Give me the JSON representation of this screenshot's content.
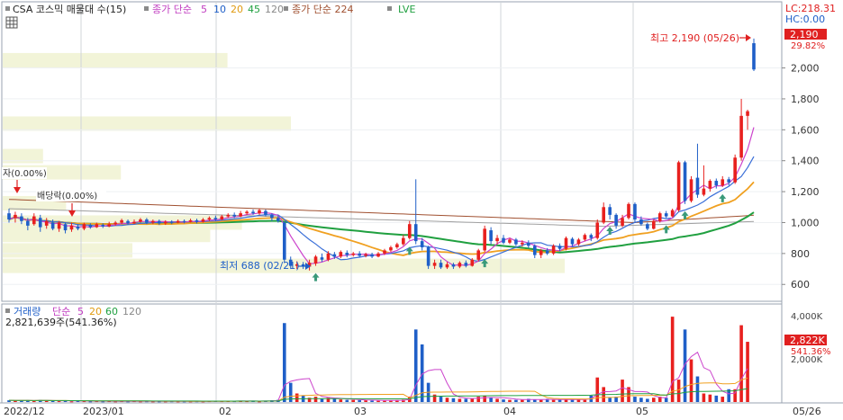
{
  "colors": {
    "up": "#e8201e",
    "down": "#1f5fc8",
    "ma5": "#cc44cc",
    "ma20": "#f0a020",
    "ma60": "#20a040",
    "ma120": "#a0a0a0",
    "ma224": "#a05030",
    "highlight": "#f2f4d8",
    "arrow_up": "#3a9a7a",
    "arrow_down": "#e02020"
  },
  "header": {
    "legend_title": "CSA 코스믹 매물대 수(15)",
    "price_ma_label": "종가 단순",
    "ma_periods": [
      "5",
      "10",
      "20",
      "45",
      "120"
    ],
    "ma224_label": "종가 단순 224",
    "lve_label": "LVE",
    "lc_label": "LC:218.31",
    "hc_label": "HC:0.00"
  },
  "annotations": {
    "high_label": "최고 2,190 (05/26)",
    "low_label": "최저 688 (02/21)",
    "div1": "자(0.00%)",
    "div2": "배당락(0.00%)"
  },
  "price_axis": {
    "ticks": [
      "2,000",
      "1,800",
      "1,600",
      "1,400",
      "1,200",
      "1,000",
      "800",
      "600"
    ],
    "current_price": "2,190",
    "current_change": "29.82%"
  },
  "volume_panel": {
    "legend_title": "거래량",
    "legend_ma_label": "단순",
    "legend_periods": [
      "5",
      "20",
      "60",
      "120"
    ],
    "current_volume": "2,821,639주(541.36%)",
    "ticks": [
      "4,000K",
      "2,000K"
    ],
    "current_value": "2,822K",
    "current_change": "541.36%"
  },
  "x_axis": {
    "labels": [
      "2022/12",
      "2023/01",
      "02",
      "03",
      "04",
      "05",
      "05/26"
    ]
  },
  "chart_data": {
    "type": "candlestick",
    "price_range": [
      520,
      2230
    ],
    "volume_range_k": [
      0,
      4300
    ],
    "series_price": [
      {
        "o": 1060,
        "c": 1020,
        "h": 1090,
        "l": 1000
      },
      {
        "o": 1030,
        "c": 1050,
        "h": 1070,
        "l": 1000
      },
      {
        "o": 1040,
        "c": 1010,
        "h": 1060,
        "l": 990
      },
      {
        "o": 1010,
        "c": 980,
        "h": 1030,
        "l": 950
      },
      {
        "o": 990,
        "c": 1040,
        "h": 1060,
        "l": 980
      },
      {
        "o": 1030,
        "c": 970,
        "h": 1050,
        "l": 940
      },
      {
        "o": 980,
        "c": 1010,
        "h": 1030,
        "l": 960
      },
      {
        "o": 1000,
        "c": 960,
        "h": 1020,
        "l": 950
      },
      {
        "o": 960,
        "c": 1000,
        "h": 1010,
        "l": 940
      },
      {
        "o": 990,
        "c": 950,
        "h": 1000,
        "l": 930
      },
      {
        "o": 955,
        "c": 980,
        "h": 1000,
        "l": 940
      },
      {
        "o": 975,
        "c": 960,
        "h": 990,
        "l": 950
      },
      {
        "o": 960,
        "c": 990,
        "h": 1000,
        "l": 950
      },
      {
        "o": 985,
        "c": 970,
        "h": 995,
        "l": 960
      },
      {
        "o": 970,
        "c": 990,
        "h": 1000,
        "l": 965
      },
      {
        "o": 985,
        "c": 975,
        "h": 995,
        "l": 965
      },
      {
        "o": 975,
        "c": 990,
        "h": 1005,
        "l": 970
      },
      {
        "o": 990,
        "c": 1000,
        "h": 1010,
        "l": 980
      },
      {
        "o": 1000,
        "c": 1015,
        "h": 1025,
        "l": 990
      },
      {
        "o": 1010,
        "c": 995,
        "h": 1020,
        "l": 985
      },
      {
        "o": 995,
        "c": 1005,
        "h": 1020,
        "l": 990
      },
      {
        "o": 1005,
        "c": 1020,
        "h": 1030,
        "l": 1000
      },
      {
        "o": 1020,
        "c": 1000,
        "h": 1030,
        "l": 990
      },
      {
        "o": 1000,
        "c": 1010,
        "h": 1020,
        "l": 990
      },
      {
        "o": 1010,
        "c": 995,
        "h": 1020,
        "l": 985
      },
      {
        "o": 995,
        "c": 1005,
        "h": 1015,
        "l": 985
      },
      {
        "o": 1005,
        "c": 1000,
        "h": 1015,
        "l": 990
      },
      {
        "o": 1000,
        "c": 1010,
        "h": 1020,
        "l": 995
      },
      {
        "o": 1010,
        "c": 1005,
        "h": 1020,
        "l": 995
      },
      {
        "o": 1005,
        "c": 1015,
        "h": 1025,
        "l": 1000
      },
      {
        "o": 1015,
        "c": 1005,
        "h": 1025,
        "l": 995
      },
      {
        "o": 1005,
        "c": 1020,
        "h": 1030,
        "l": 1000
      },
      {
        "o": 1020,
        "c": 1030,
        "h": 1040,
        "l": 1010
      },
      {
        "o": 1030,
        "c": 1020,
        "h": 1045,
        "l": 1010
      },
      {
        "o": 1020,
        "c": 1040,
        "h": 1050,
        "l": 1015
      },
      {
        "o": 1040,
        "c": 1050,
        "h": 1060,
        "l": 1030
      },
      {
        "o": 1050,
        "c": 1040,
        "h": 1065,
        "l": 1030
      },
      {
        "o": 1040,
        "c": 1060,
        "h": 1075,
        "l": 1035
      },
      {
        "o": 1060,
        "c": 1070,
        "h": 1080,
        "l": 1050
      },
      {
        "o": 1070,
        "c": 1060,
        "h": 1085,
        "l": 1050
      },
      {
        "o": 1060,
        "c": 1080,
        "h": 1090,
        "l": 1050
      },
      {
        "o": 1075,
        "c": 1050,
        "h": 1085,
        "l": 1040
      },
      {
        "o": 1050,
        "c": 1030,
        "h": 1060,
        "l": 1010
      },
      {
        "o": 1030,
        "c": 1010,
        "h": 1045,
        "l": 1000
      },
      {
        "o": 1000,
        "c": 760,
        "h": 1010,
        "l": 740
      },
      {
        "o": 760,
        "c": 720,
        "h": 780,
        "l": 700
      },
      {
        "o": 720,
        "c": 730,
        "h": 750,
        "l": 700
      },
      {
        "o": 730,
        "c": 715,
        "h": 745,
        "l": 700
      },
      {
        "o": 715,
        "c": 740,
        "h": 760,
        "l": 690
      },
      {
        "o": 735,
        "c": 780,
        "h": 790,
        "l": 720
      },
      {
        "o": 775,
        "c": 760,
        "h": 800,
        "l": 745
      },
      {
        "o": 760,
        "c": 800,
        "h": 815,
        "l": 750
      },
      {
        "o": 795,
        "c": 780,
        "h": 810,
        "l": 765
      },
      {
        "o": 780,
        "c": 810,
        "h": 820,
        "l": 770
      },
      {
        "o": 805,
        "c": 790,
        "h": 820,
        "l": 775
      },
      {
        "o": 790,
        "c": 800,
        "h": 810,
        "l": 780
      },
      {
        "o": 800,
        "c": 785,
        "h": 815,
        "l": 775
      },
      {
        "o": 785,
        "c": 795,
        "h": 805,
        "l": 775
      },
      {
        "o": 795,
        "c": 780,
        "h": 805,
        "l": 770
      },
      {
        "o": 780,
        "c": 800,
        "h": 810,
        "l": 775
      },
      {
        "o": 800,
        "c": 820,
        "h": 830,
        "l": 790
      },
      {
        "o": 820,
        "c": 840,
        "h": 850,
        "l": 810
      },
      {
        "o": 840,
        "c": 860,
        "h": 870,
        "l": 830
      },
      {
        "o": 860,
        "c": 900,
        "h": 920,
        "l": 850
      },
      {
        "o": 900,
        "c": 990,
        "h": 1010,
        "l": 890
      },
      {
        "o": 990,
        "c": 880,
        "h": 1280,
        "l": 860
      },
      {
        "o": 880,
        "c": 840,
        "h": 900,
        "l": 820
      },
      {
        "o": 840,
        "c": 720,
        "h": 850,
        "l": 700
      },
      {
        "o": 720,
        "c": 740,
        "h": 760,
        "l": 700
      },
      {
        "o": 740,
        "c": 710,
        "h": 760,
        "l": 700
      },
      {
        "o": 710,
        "c": 730,
        "h": 745,
        "l": 700
      },
      {
        "o": 730,
        "c": 715,
        "h": 740,
        "l": 700
      },
      {
        "o": 715,
        "c": 740,
        "h": 750,
        "l": 705
      },
      {
        "o": 740,
        "c": 720,
        "h": 755,
        "l": 710
      },
      {
        "o": 720,
        "c": 760,
        "h": 770,
        "l": 715
      },
      {
        "o": 760,
        "c": 820,
        "h": 830,
        "l": 750
      },
      {
        "o": 820,
        "c": 960,
        "h": 980,
        "l": 810
      },
      {
        "o": 950,
        "c": 880,
        "h": 970,
        "l": 860
      },
      {
        "o": 880,
        "c": 900,
        "h": 920,
        "l": 860
      },
      {
        "o": 900,
        "c": 870,
        "h": 920,
        "l": 860
      },
      {
        "o": 870,
        "c": 890,
        "h": 900,
        "l": 860
      },
      {
        "o": 890,
        "c": 860,
        "h": 900,
        "l": 850
      },
      {
        "o": 860,
        "c": 870,
        "h": 885,
        "l": 845
      },
      {
        "o": 870,
        "c": 850,
        "h": 885,
        "l": 835
      },
      {
        "o": 850,
        "c": 790,
        "h": 860,
        "l": 770
      },
      {
        "o": 790,
        "c": 820,
        "h": 830,
        "l": 770
      },
      {
        "o": 820,
        "c": 800,
        "h": 835,
        "l": 790
      },
      {
        "o": 800,
        "c": 850,
        "h": 860,
        "l": 790
      },
      {
        "o": 850,
        "c": 830,
        "h": 865,
        "l": 815
      },
      {
        "o": 830,
        "c": 900,
        "h": 910,
        "l": 820
      },
      {
        "o": 895,
        "c": 860,
        "h": 905,
        "l": 845
      },
      {
        "o": 860,
        "c": 890,
        "h": 900,
        "l": 850
      },
      {
        "o": 890,
        "c": 920,
        "h": 930,
        "l": 880
      },
      {
        "o": 920,
        "c": 900,
        "h": 930,
        "l": 880
      },
      {
        "o": 900,
        "c": 1000,
        "h": 1020,
        "l": 890
      },
      {
        "o": 1000,
        "c": 1100,
        "h": 1130,
        "l": 990
      },
      {
        "o": 1100,
        "c": 1050,
        "h": 1120,
        "l": 1020
      },
      {
        "o": 1050,
        "c": 980,
        "h": 1060,
        "l": 960
      },
      {
        "o": 980,
        "c": 1030,
        "h": 1050,
        "l": 970
      },
      {
        "o": 1030,
        "c": 1120,
        "h": 1130,
        "l": 1020
      },
      {
        "o": 1120,
        "c": 1020,
        "h": 1130,
        "l": 1000
      },
      {
        "o": 1020,
        "c": 990,
        "h": 1040,
        "l": 980
      },
      {
        "o": 990,
        "c": 960,
        "h": 1000,
        "l": 950
      },
      {
        "o": 960,
        "c": 1010,
        "h": 1020,
        "l": 955
      },
      {
        "o": 1010,
        "c": 1060,
        "h": 1070,
        "l": 1000
      },
      {
        "o": 1060,
        "c": 1040,
        "h": 1075,
        "l": 1030
      },
      {
        "o": 1040,
        "c": 1080,
        "h": 1090,
        "l": 1035
      },
      {
        "o": 1080,
        "c": 1390,
        "h": 1400,
        "l": 1070
      },
      {
        "o": 1390,
        "c": 1140,
        "h": 1400,
        "l": 1120
      },
      {
        "o": 1140,
        "c": 1280,
        "h": 1300,
        "l": 1130
      },
      {
        "o": 1290,
        "c": 1180,
        "h": 1510,
        "l": 1160
      },
      {
        "o": 1180,
        "c": 1220,
        "h": 1370,
        "l": 1170
      },
      {
        "o": 1220,
        "c": 1270,
        "h": 1280,
        "l": 1200
      },
      {
        "o": 1270,
        "c": 1240,
        "h": 1285,
        "l": 1220
      },
      {
        "o": 1240,
        "c": 1280,
        "h": 1300,
        "l": 1230
      },
      {
        "o": 1280,
        "c": 1260,
        "h": 1295,
        "l": 1240
      },
      {
        "o": 1260,
        "c": 1420,
        "h": 1440,
        "l": 1250
      },
      {
        "o": 1420,
        "c": 1690,
        "h": 1800,
        "l": 1400
      },
      {
        "o": 1690,
        "c": 1720,
        "h": 1730,
        "l": 1600
      },
      {
        "o": 2160,
        "c": 1990,
        "h": 2190,
        "l": 1980
      }
    ],
    "series_volume_k": [
      80,
      60,
      70,
      90,
      40,
      100,
      50,
      60,
      40,
      70,
      30,
      50,
      40,
      30,
      40,
      30,
      40,
      30,
      40,
      30,
      40,
      30,
      35,
      30,
      30,
      30,
      35,
      30,
      30,
      30,
      35,
      30,
      40,
      50,
      40,
      50,
      40,
      60,
      40,
      50,
      30,
      60,
      80,
      100,
      3700,
      900,
      400,
      300,
      200,
      250,
      150,
      200,
      150,
      120,
      100,
      100,
      90,
      80,
      70,
      60,
      60,
      80,
      90,
      110,
      250,
      3400,
      2700,
      900,
      350,
      250,
      200,
      180,
      150,
      150,
      150,
      250,
      300,
      200,
      150,
      120,
      100,
      100,
      100,
      150,
      120,
      100,
      150,
      100,
      120,
      120,
      100,
      150,
      100,
      300,
      1150,
      700,
      200,
      250,
      1050,
      700,
      250,
      200,
      150,
      200,
      250,
      200,
      4000,
      1050,
      3400,
      2000,
      1200,
      400,
      350,
      300,
      250,
      600,
      600,
      3600,
      2822
    ],
    "ma_lines": [
      {
        "name": "5",
        "color": "ma5"
      },
      {
        "name": "20",
        "color": "ma20"
      },
      {
        "name": "60",
        "color": "ma60"
      },
      {
        "name": "120",
        "color": "ma120"
      },
      {
        "name": "224",
        "color": "ma224"
      }
    ],
    "volume_profile_bars": [
      {
        "price": 2050,
        "width": 0.78
      },
      {
        "price": 1640,
        "width": 1.0
      },
      {
        "price": 1430,
        "width": 0.14
      },
      {
        "price": 1325,
        "width": 0.41
      },
      {
        "price": 1125,
        "width": 0.22
      },
      {
        "price": 1000,
        "width": 0.83
      },
      {
        "price": 920,
        "width": 0.72
      },
      {
        "price": 820,
        "width": 0.45
      },
      {
        "price": 720,
        "width": 1.95
      }
    ],
    "high": {
      "value": 2190,
      "date": "05/26"
    },
    "low": {
      "value": 688,
      "date": "02/21"
    }
  }
}
